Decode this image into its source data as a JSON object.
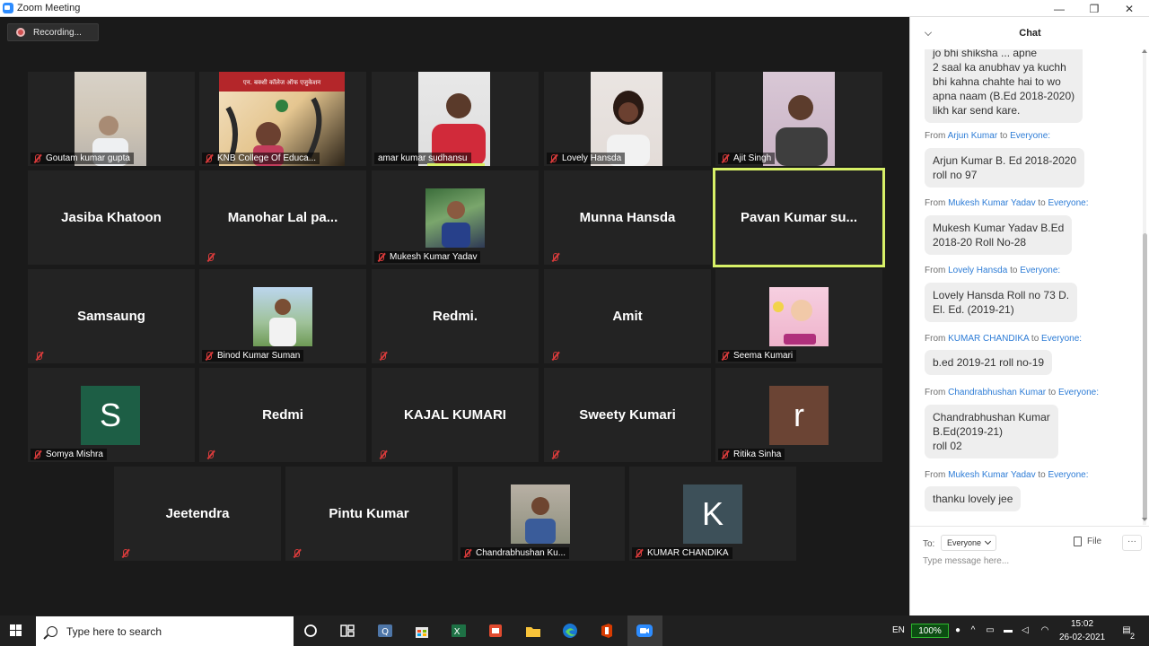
{
  "window": {
    "title": "Zoom Meeting",
    "controls": {
      "minimize": "—",
      "maximize": "❐",
      "close": "✕"
    }
  },
  "meeting": {
    "recording_label": "Recording...",
    "tiles_row1": [
      {
        "name": "Goutam kumar gupta",
        "kind": "video",
        "muted": true
      },
      {
        "name": "KNB College Of Educa...",
        "kind": "video",
        "muted": true
      },
      {
        "name": "amar kumar sudhansu",
        "kind": "video",
        "muted": false
      },
      {
        "name": "Lovely Hansda",
        "kind": "video",
        "muted": true
      },
      {
        "name": "Ajit Singh",
        "kind": "video",
        "muted": true
      }
    ],
    "tiles_row2": [
      {
        "name": "Jasiba Khatoon",
        "kind": "name"
      },
      {
        "name": "Manohar Lal pa...",
        "kind": "name"
      },
      {
        "name": "Mukesh Kumar Yadav",
        "kind": "thumb"
      },
      {
        "name": "Munna Hansda",
        "kind": "name"
      },
      {
        "name": "Pavan Kumar su...",
        "kind": "name",
        "active": true
      }
    ],
    "tiles_row3": [
      {
        "name": "Samsaung",
        "kind": "name"
      },
      {
        "name": "Binod Kumar Suman",
        "kind": "thumb"
      },
      {
        "name": "Redmi.",
        "kind": "name"
      },
      {
        "name": "Amit",
        "kind": "name"
      },
      {
        "name": "Seema Kumari",
        "kind": "thumb"
      }
    ],
    "tiles_row4": [
      {
        "name": "Somya Mishra",
        "kind": "letter",
        "letter": "S",
        "color": "#1d5e45"
      },
      {
        "name": "Redmi",
        "kind": "name"
      },
      {
        "name": "KAJAL KUMARI",
        "kind": "name"
      },
      {
        "name": "Sweety Kumari",
        "kind": "name"
      },
      {
        "name": "Ritika Sinha",
        "kind": "letter",
        "letter": "r",
        "color": "#6b4434"
      }
    ],
    "tiles_row5": [
      {
        "name": "Jeetendra",
        "kind": "name"
      },
      {
        "name": "Pintu Kumar",
        "kind": "name"
      },
      {
        "name": "Chandrabhushan Ku...",
        "kind": "thumb"
      },
      {
        "name": "KUMAR CHANDIKA",
        "kind": "letter",
        "letter": "K",
        "color": "#3d5059"
      }
    ],
    "banner_texts": {
      "college": "एन. बक्शी कॉलेज ऑफ एजुकेशन"
    }
  },
  "chat": {
    "title": "Chat",
    "messages": [
      {
        "from": "",
        "to": "",
        "lines": [
          "jo bhi shiksha ... apne",
          "2 saal ka anubhav ya kuchh",
          "bhi kahna chahte hai to wo",
          "apna naam  (B.Ed 2018-2020)",
          "likh kar send kare."
        ]
      },
      {
        "from": "Arjun Kumar",
        "to": "Everyone:",
        "lines": [
          "Arjun Kumar B. Ed 2018-2020",
          "roll no 97"
        ]
      },
      {
        "from": "Mukesh Kumar Yadav",
        "to": "Everyone:",
        "lines": [
          "Mukesh Kumar Yadav B.Ed",
          "2018-20 Roll No-28"
        ]
      },
      {
        "from": "Lovely Hansda",
        "to": "Everyone:",
        "lines": [
          "Lovely Hansda Roll no 73 D.",
          "El. Ed. (2019-21)"
        ]
      },
      {
        "from": "KUMAR CHANDIKA",
        "to": "Everyone:",
        "lines": [
          "b.ed 2019-21 roll no-19"
        ]
      },
      {
        "from": "Chandrabhushan Kumar",
        "to": "Everyone:",
        "lines": [
          "Chandrabhushan Kumar",
          "B.Ed(2019-21)",
          "roll 02"
        ]
      },
      {
        "from": "Mukesh Kumar Yadav",
        "to": "Everyone:",
        "lines": [
          "thanku lovely jee"
        ]
      }
    ],
    "from_prefix": "From",
    "to_word": "to",
    "compose": {
      "to_label": "To:",
      "recipient": "Everyone",
      "file_label": "File",
      "more_label": "···",
      "placeholder": "Type message here..."
    }
  },
  "taskbar": {
    "search_placeholder": "Type here to search",
    "language": "EN",
    "battery": "100%",
    "time": "15:02",
    "date": "26-02-2021",
    "notifications": "2"
  }
}
